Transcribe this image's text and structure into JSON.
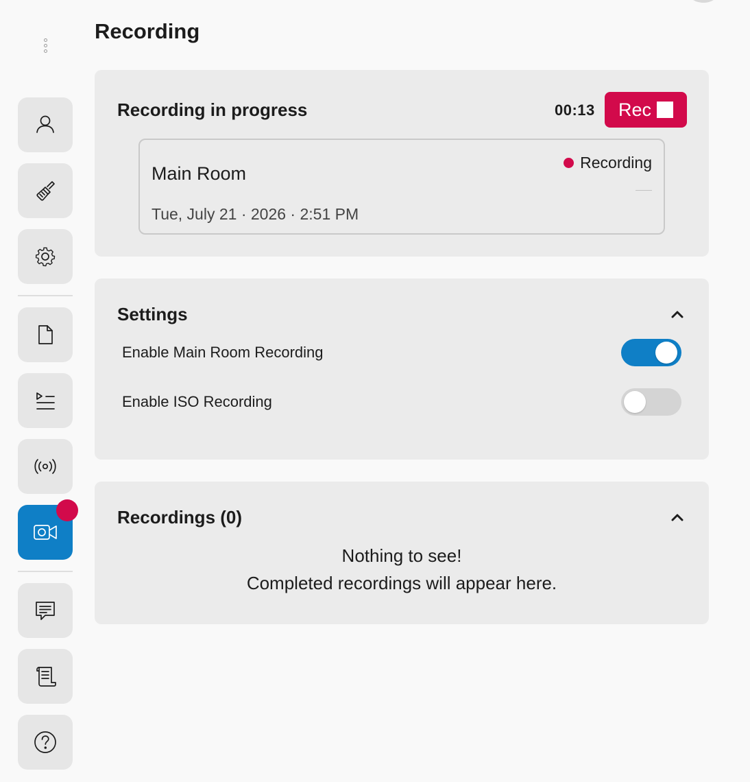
{
  "page": {
    "title": "Recording"
  },
  "sidebar": {
    "items": [
      {
        "name": "participants",
        "icon": "user-icon"
      },
      {
        "name": "appearance",
        "icon": "brush-icon"
      },
      {
        "name": "settings",
        "icon": "gear-icon"
      },
      {
        "name": "documents",
        "icon": "file-icon"
      },
      {
        "name": "playlist",
        "icon": "playlist-icon"
      },
      {
        "name": "broadcast",
        "icon": "broadcast-icon"
      },
      {
        "name": "recording",
        "icon": "video-camera-icon",
        "active": true,
        "has_notification": true
      },
      {
        "name": "chat",
        "icon": "chat-icon"
      },
      {
        "name": "script",
        "icon": "scroll-icon"
      },
      {
        "name": "help",
        "icon": "help-icon"
      }
    ]
  },
  "recording_panel": {
    "title": "Recording in progress",
    "timer": "00:13",
    "rec_button_label": "Rec",
    "session": {
      "name": "Main Room",
      "status": "Recording",
      "date": "Tue, July 21 · 2026 · 2:51 PM"
    }
  },
  "settings_panel": {
    "title": "Settings",
    "items": [
      {
        "label": "Enable Main Room Recording",
        "enabled": true
      },
      {
        "label": "Enable ISO Recording",
        "enabled": false
      }
    ]
  },
  "recordings_panel": {
    "title": "Recordings (0)",
    "empty_line1": "Nothing to see!",
    "empty_line2": "Completed recordings will appear here."
  },
  "colors": {
    "accent": "#0f7fc6",
    "record": "#d20a4b",
    "panel": "#ebebeb",
    "background": "#f9f9f9"
  }
}
